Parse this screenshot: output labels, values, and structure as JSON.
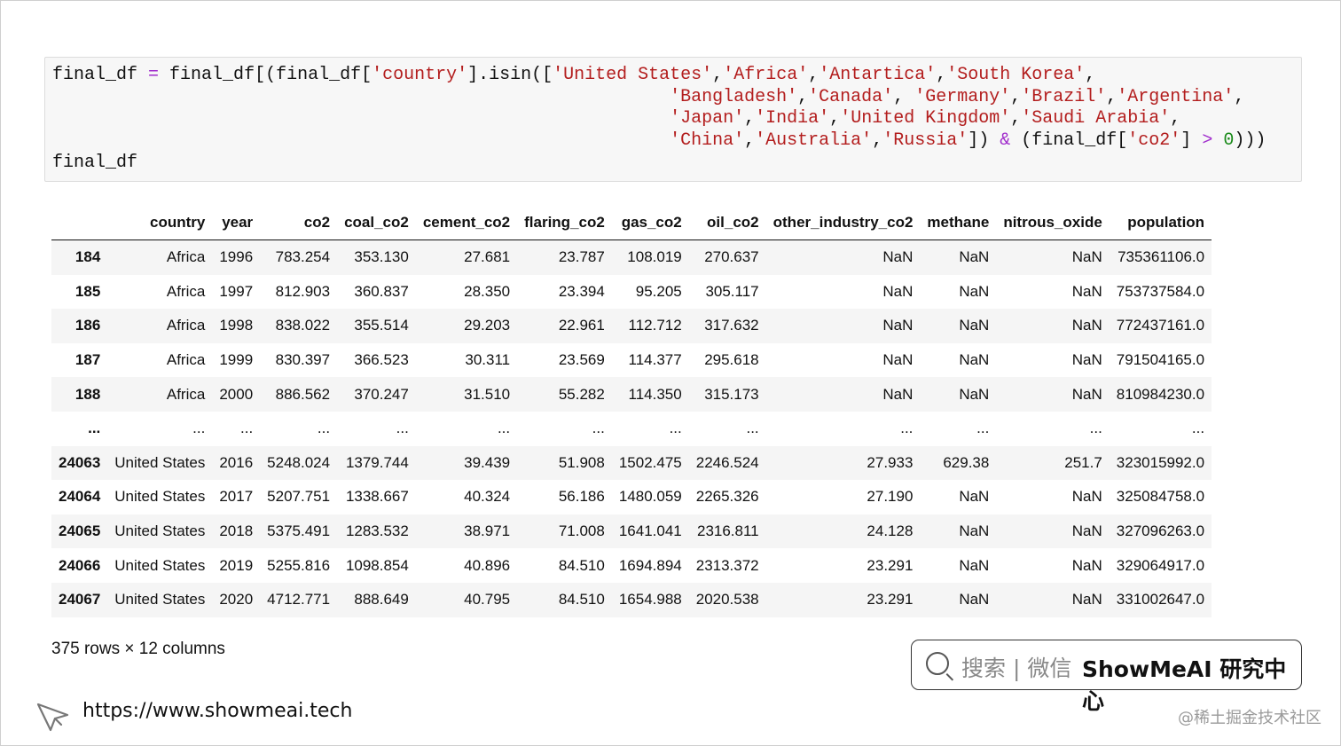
{
  "code": {
    "line1": {
      "a": "final_df ",
      "op1": "=",
      "b": " final_df[(final_df[",
      "s1": "'country'",
      "c": "].isin([",
      "s2": "'United States'",
      "d": ",",
      "s3": "'Africa'",
      "e": ",",
      "s4": "'Antartica'",
      "f": ",",
      "s5": "'South Korea'",
      "g": ","
    },
    "line2": {
      "indent": "                                                          ",
      "s1": "'Bangladesh'",
      "a": ",",
      "s2": "'Canada'",
      "b": ", ",
      "s3": "'Germany'",
      "c": ",",
      "s4": "'Brazil'",
      "d": ",",
      "s5": "'Argentina'",
      "e": ","
    },
    "line3": {
      "indent": "                                                          ",
      "s1": "'Japan'",
      "a": ",",
      "s2": "'India'",
      "b": ",",
      "s3": "'United Kingdom'",
      "c": ",",
      "s4": "'Saudi Arabia'",
      "d": ","
    },
    "line4": {
      "indent": "                                                          ",
      "s1": "'China'",
      "a": ",",
      "s2": "'Australia'",
      "b": ",",
      "s3": "'Russia'",
      "c": "]) ",
      "op1": "&",
      "d": " (final_df[",
      "s4": "'co2'",
      "e": "] ",
      "op2": ">",
      "f": " ",
      "n1": "0",
      "g": ")))"
    },
    "line5": "final_df"
  },
  "table": {
    "columns": [
      "country",
      "year",
      "co2",
      "coal_co2",
      "cement_co2",
      "flaring_co2",
      "gas_co2",
      "oil_co2",
      "other_industry_co2",
      "methane",
      "nitrous_oxide",
      "population"
    ],
    "rows": [
      {
        "index": "184",
        "cells": [
          "Africa",
          "1996",
          "783.254",
          "353.130",
          "27.681",
          "23.787",
          "108.019",
          "270.637",
          "NaN",
          "NaN",
          "NaN",
          "735361106.0"
        ]
      },
      {
        "index": "185",
        "cells": [
          "Africa",
          "1997",
          "812.903",
          "360.837",
          "28.350",
          "23.394",
          "95.205",
          "305.117",
          "NaN",
          "NaN",
          "NaN",
          "753737584.0"
        ]
      },
      {
        "index": "186",
        "cells": [
          "Africa",
          "1998",
          "838.022",
          "355.514",
          "29.203",
          "22.961",
          "112.712",
          "317.632",
          "NaN",
          "NaN",
          "NaN",
          "772437161.0"
        ]
      },
      {
        "index": "187",
        "cells": [
          "Africa",
          "1999",
          "830.397",
          "366.523",
          "30.311",
          "23.569",
          "114.377",
          "295.618",
          "NaN",
          "NaN",
          "NaN",
          "791504165.0"
        ]
      },
      {
        "index": "188",
        "cells": [
          "Africa",
          "2000",
          "886.562",
          "370.247",
          "31.510",
          "55.282",
          "114.350",
          "315.173",
          "NaN",
          "NaN",
          "NaN",
          "810984230.0"
        ]
      },
      {
        "index": "...",
        "cells": [
          "...",
          "...",
          "...",
          "...",
          "...",
          "...",
          "...",
          "...",
          "...",
          "...",
          "...",
          "..."
        ]
      },
      {
        "index": "24063",
        "cells": [
          "United States",
          "2016",
          "5248.024",
          "1379.744",
          "39.439",
          "51.908",
          "1502.475",
          "2246.524",
          "27.933",
          "629.38",
          "251.7",
          "323015992.0"
        ]
      },
      {
        "index": "24064",
        "cells": [
          "United States",
          "2017",
          "5207.751",
          "1338.667",
          "40.324",
          "56.186",
          "1480.059",
          "2265.326",
          "27.190",
          "NaN",
          "NaN",
          "325084758.0"
        ]
      },
      {
        "index": "24065",
        "cells": [
          "United States",
          "2018",
          "5375.491",
          "1283.532",
          "38.971",
          "71.008",
          "1641.041",
          "2316.811",
          "24.128",
          "NaN",
          "NaN",
          "327096263.0"
        ]
      },
      {
        "index": "24066",
        "cells": [
          "United States",
          "2019",
          "5255.816",
          "1098.854",
          "40.896",
          "84.510",
          "1694.894",
          "2313.372",
          "23.291",
          "NaN",
          "NaN",
          "329064917.0"
        ]
      },
      {
        "index": "24067",
        "cells": [
          "United States",
          "2020",
          "4712.771",
          "888.649",
          "40.795",
          "84.510",
          "1654.988",
          "2020.538",
          "23.291",
          "NaN",
          "NaN",
          "331002647.0"
        ]
      }
    ]
  },
  "summary": "375 rows × 12 columns",
  "brand": {
    "search_text": "搜索 | 微信",
    "name": "ShowMeAI 研究中心"
  },
  "footer": {
    "url": "https://www.showmeai.tech",
    "watermark": "@稀土掘金技术社区"
  },
  "colors": {
    "code_background": "#f7f7f7",
    "operator": "#a02ccc",
    "string": "#b31d1d",
    "number": "#1a8a1a",
    "row_stripe": "#f5f5f5"
  }
}
